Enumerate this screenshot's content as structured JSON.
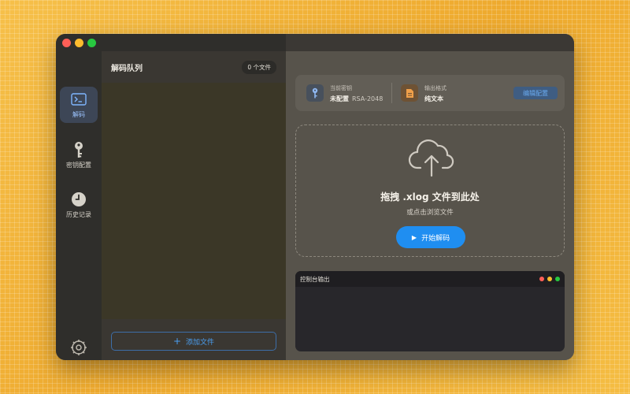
{
  "sidebar": {
    "items": [
      {
        "label": "解码",
        "icon": "terminal-icon",
        "active": true
      },
      {
        "label": "密钥配置",
        "icon": "key-icon",
        "active": false
      },
      {
        "label": "历史记录",
        "icon": "clock-icon",
        "active": false
      }
    ],
    "settings_icon": "gear-icon"
  },
  "queue": {
    "title": "解码队列",
    "count_label": "0 个文件",
    "add_button_label": "添加文件"
  },
  "info_card": {
    "key_caption": "当前密钥",
    "key_status": "未配置",
    "key_type": "RSA-2048",
    "format_caption": "输出格式",
    "format_value": "纯文本",
    "edit_button": "编辑配置"
  },
  "dropzone": {
    "title": "拖拽 .xlog 文件到此处",
    "subtitle": "或点击浏览文件",
    "start_button": "开始解码"
  },
  "console": {
    "title": "控制台输出"
  },
  "colors": {
    "accent": "#1f8ef1",
    "background": "#f2b23a",
    "sidebar": "#2f2e2b",
    "main": "#57534b"
  }
}
